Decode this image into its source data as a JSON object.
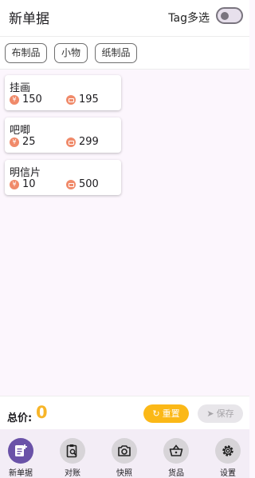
{
  "header": {
    "title": "新单据",
    "tag_multi_label": "Tag多选",
    "tag_multi_enabled": false
  },
  "tags": [
    "布制品",
    "小物",
    "纸制品"
  ],
  "items": [
    {
      "name": "挂画",
      "price": "150",
      "stock": "195"
    },
    {
      "name": "吧唧",
      "price": "25",
      "stock": "299"
    },
    {
      "name": "明信片",
      "price": "10",
      "stock": "500"
    }
  ],
  "icons": {
    "price": "yen-icon",
    "stock": "inventory-icon"
  },
  "currency_symbol": "¥",
  "footer": {
    "total_label": "总价:",
    "total_value": "0",
    "reset_label": "重置",
    "save_label": "保存"
  },
  "nav": [
    {
      "label": "新单据",
      "icon": "new-order-icon",
      "active": true
    },
    {
      "label": "对账",
      "icon": "reconcile-icon",
      "active": false
    },
    {
      "label": "快照",
      "icon": "camera-icon",
      "active": false
    },
    {
      "label": "货品",
      "icon": "basket-icon",
      "active": false
    },
    {
      "label": "设置",
      "icon": "gear-icon",
      "active": false
    }
  ],
  "colors": {
    "accent": "#fbb817",
    "total": "#f7b529",
    "nav_active": "#6a52a8",
    "icon_badge": "#f08a6a"
  }
}
